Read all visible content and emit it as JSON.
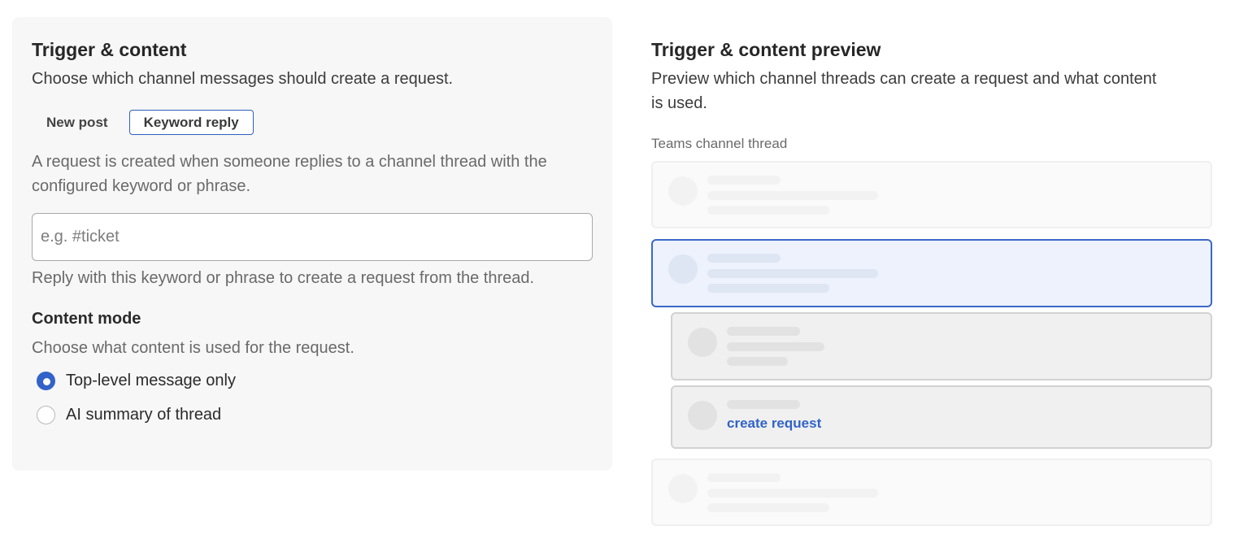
{
  "left": {
    "title": "Trigger & content",
    "subtitle": "Choose which channel messages should create a request.",
    "tabs": [
      {
        "label": "New post",
        "active": false
      },
      {
        "label": "Keyword reply",
        "active": true
      }
    ],
    "description": "A request is created when someone replies to a channel thread with the configured keyword or phrase.",
    "keyword_input": {
      "value": "",
      "placeholder": "e.g. #ticket"
    },
    "keyword_hint": "Reply with this keyword or phrase to create a request from the thread.",
    "content_mode": {
      "title": "Content mode",
      "subtitle": "Choose what content is used for the request.",
      "options": [
        {
          "label": "Top-level message only",
          "checked": true
        },
        {
          "label": "AI summary of thread",
          "checked": false
        }
      ]
    }
  },
  "right": {
    "title": "Trigger & content preview",
    "subtitle": "Preview which channel threads can create a request and what content is used.",
    "label": "Teams channel thread",
    "reply_link": "create request"
  },
  "colors": {
    "accent": "#3163c9",
    "selected_bg": "#edf2fc",
    "card_bg": "#f7f7f7"
  }
}
